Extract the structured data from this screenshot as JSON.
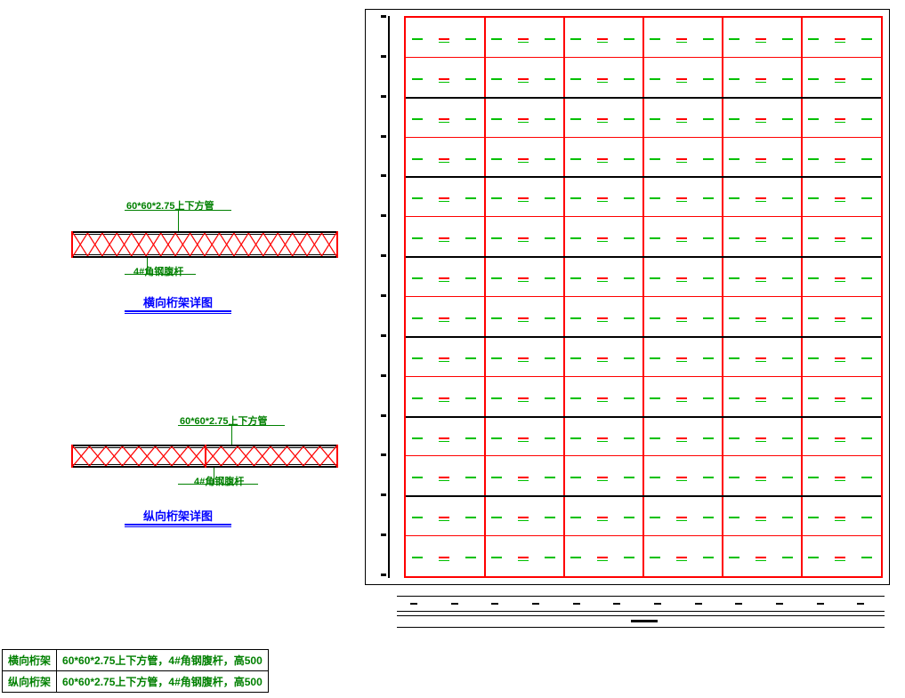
{
  "truss1": {
    "callout_top": "60*60*2.75上下方管",
    "callout_bottom": "4#角钢腹杆",
    "title": "横向桁架详图"
  },
  "truss2": {
    "callout_top": "60*60*2.75上下方管",
    "callout_bottom": "4#角钢腹杆",
    "title": "纵向桁架详图"
  },
  "spec_table": {
    "rows": [
      {
        "label": "横向桁架",
        "desc": "60*60*2.75上下方管，4#角钢腹杆，高500"
      },
      {
        "label": "纵向桁架",
        "desc": "60*60*2.75上下方管，4#角钢腹杆，高500"
      }
    ]
  },
  "chart_data": {
    "type": "table",
    "description": "CAD structural drawing — plan grid + two truss elevation details",
    "plan_grid": {
      "columns": 6,
      "rows_wide": 7,
      "subrows_per_wide": 2,
      "vertical_gridline_color": "#ff0000",
      "horizontal_major_color": "#000000",
      "horizontal_minor_color": "#ff0000",
      "marks_per_cell": [
        "green",
        "red-green",
        "green"
      ],
      "outer_border": "#000000",
      "inner_border": "#ff0000"
    },
    "truss_details": [
      {
        "name": "横向桁架详图",
        "top_chord": "60*60*2.75上下方管",
        "web": "4#角钢腹杆",
        "height_mm": 500,
        "bays": 18
      },
      {
        "name": "纵向桁架详图",
        "top_chord": "60*60*2.75上下方管",
        "web": "4#角钢腹杆",
        "height_mm": 500,
        "bays": 16,
        "split_center": true
      }
    ]
  }
}
